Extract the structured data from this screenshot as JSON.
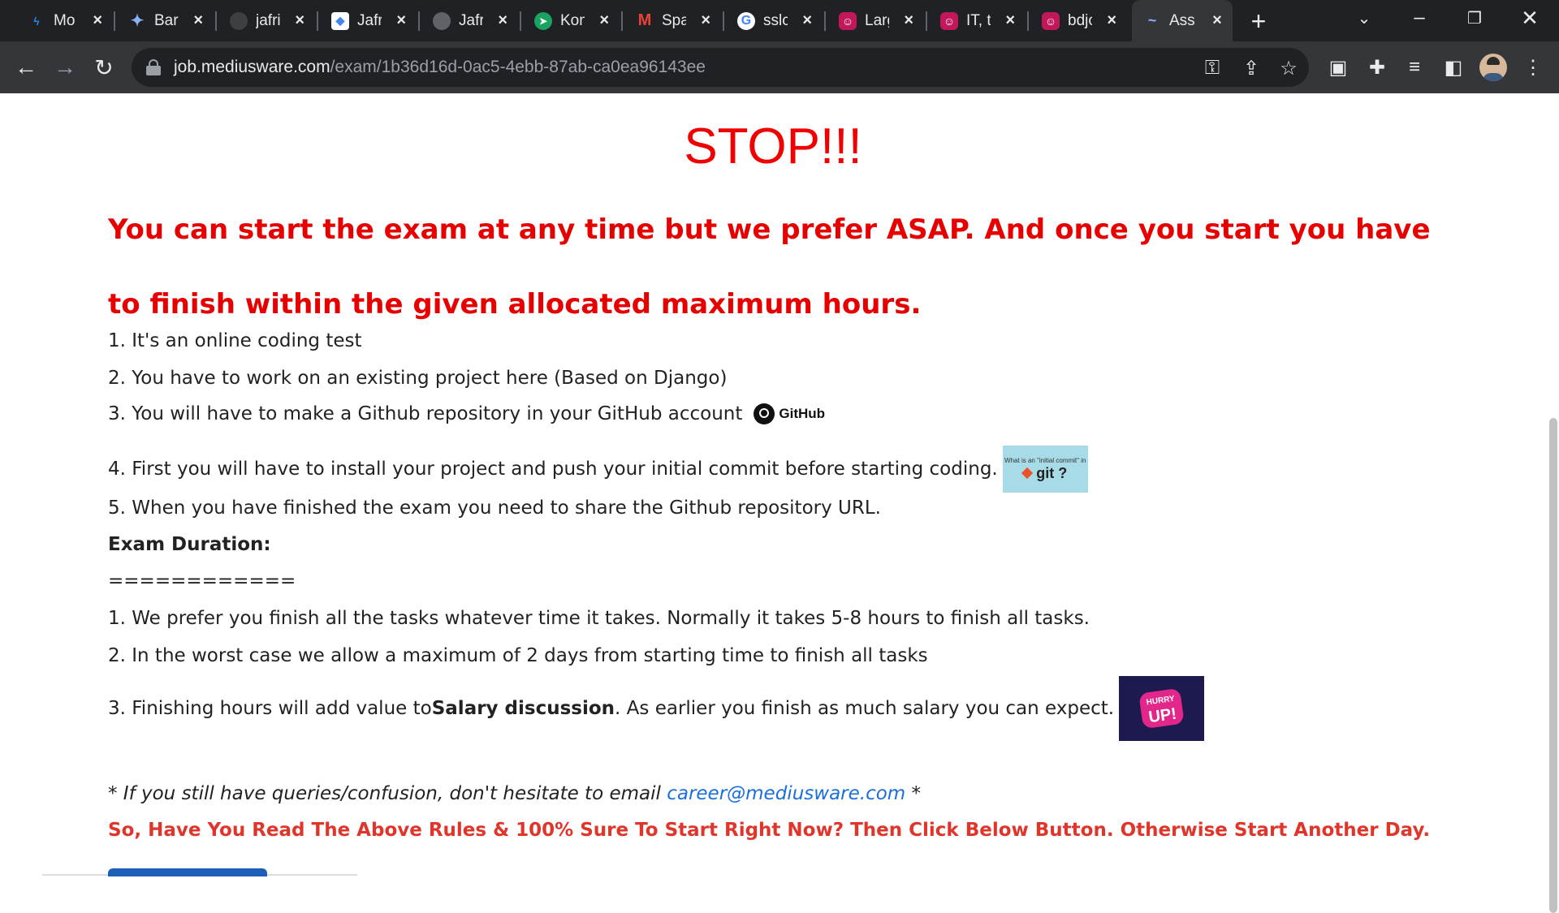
{
  "browser": {
    "tabs": [
      {
        "title": "Mo",
        "icon": "stackblitz-icon",
        "color": "#1e88e5"
      },
      {
        "title": "Bard",
        "icon": "bard-sparkle-icon",
        "color": "#8ab4f8"
      },
      {
        "title": "jafri",
        "icon": "github-icon",
        "color": "#e8eaed"
      },
      {
        "title": "Jafri",
        "icon": "google-docs-icon",
        "color": "#4285f4"
      },
      {
        "title": "Jafri",
        "icon": "globe-icon",
        "color": "#9aa0a6"
      },
      {
        "title": "Kon",
        "icon": "send-arrow-icon",
        "color": "#1aa260"
      },
      {
        "title": "Spa",
        "icon": "gmail-icon",
        "color": "#ea4335"
      },
      {
        "title": "sslc",
        "icon": "google-icon",
        "color": "#4285f4"
      },
      {
        "title": "Larg",
        "icon": "podcast-icon",
        "color": "#c2185b"
      },
      {
        "title": "IT, t",
        "icon": "podcast-icon",
        "color": "#c2185b"
      },
      {
        "title": "bdjo",
        "icon": "podcast-icon",
        "color": "#c2185b"
      },
      {
        "title": "Ass",
        "icon": "tilde-icon",
        "color": "#8ab4f8",
        "active": true
      }
    ],
    "url_host": "job.mediusware.com",
    "url_path": "/exam/1b36d16d-0ac5-4ebb-87ab-ca0ea96143ee"
  },
  "page": {
    "stop_heading": "STOP!!!",
    "warning": "You can start the exam at any time but we prefer ASAP. And once you start you have to finish within the given allocated maximum hours.",
    "rules": [
      "1. It's an online coding test",
      "2. You have to work on an existing project here (Based on Django)",
      "3. You will have to make a Github repository in your GitHub account",
      "4. First you will have to install your project and push your initial commit before starting coding.",
      "5. When you have finished the exam you need to share the Github repository URL."
    ],
    "github_logo_text": "GitHub",
    "git_thumb": {
      "caption": "What is an \"initial commit\" in",
      "word": "git ?"
    },
    "exam_duration_title": "Exam Duration:",
    "separator": "============",
    "duration_rules": [
      "1. We prefer you finish all the tasks whatever time it takes. Normally it takes 5-8 hours to finish all tasks.",
      "2. In the worst case we allow a maximum of 2 days from starting time to finish all tasks"
    ],
    "duration_rule3_prefix": "3. Finishing hours will add value to ",
    "duration_rule3_bold": "Salary discussion",
    "duration_rule3_suffix": ". As earlier you finish as much salary you can expect.",
    "hurry_badge": {
      "small": "HURRY",
      "big": "UP!"
    },
    "query_prefix": "* If you still have queries/confusion, don't hesitate to email ",
    "query_email": "career@mediusware.com",
    "query_suffix": " *",
    "final_line": "So, Have You Read The Above Rules & 100% Sure To Start Right Now? Then Click Below Button. Otherwise Start Another Day."
  }
}
